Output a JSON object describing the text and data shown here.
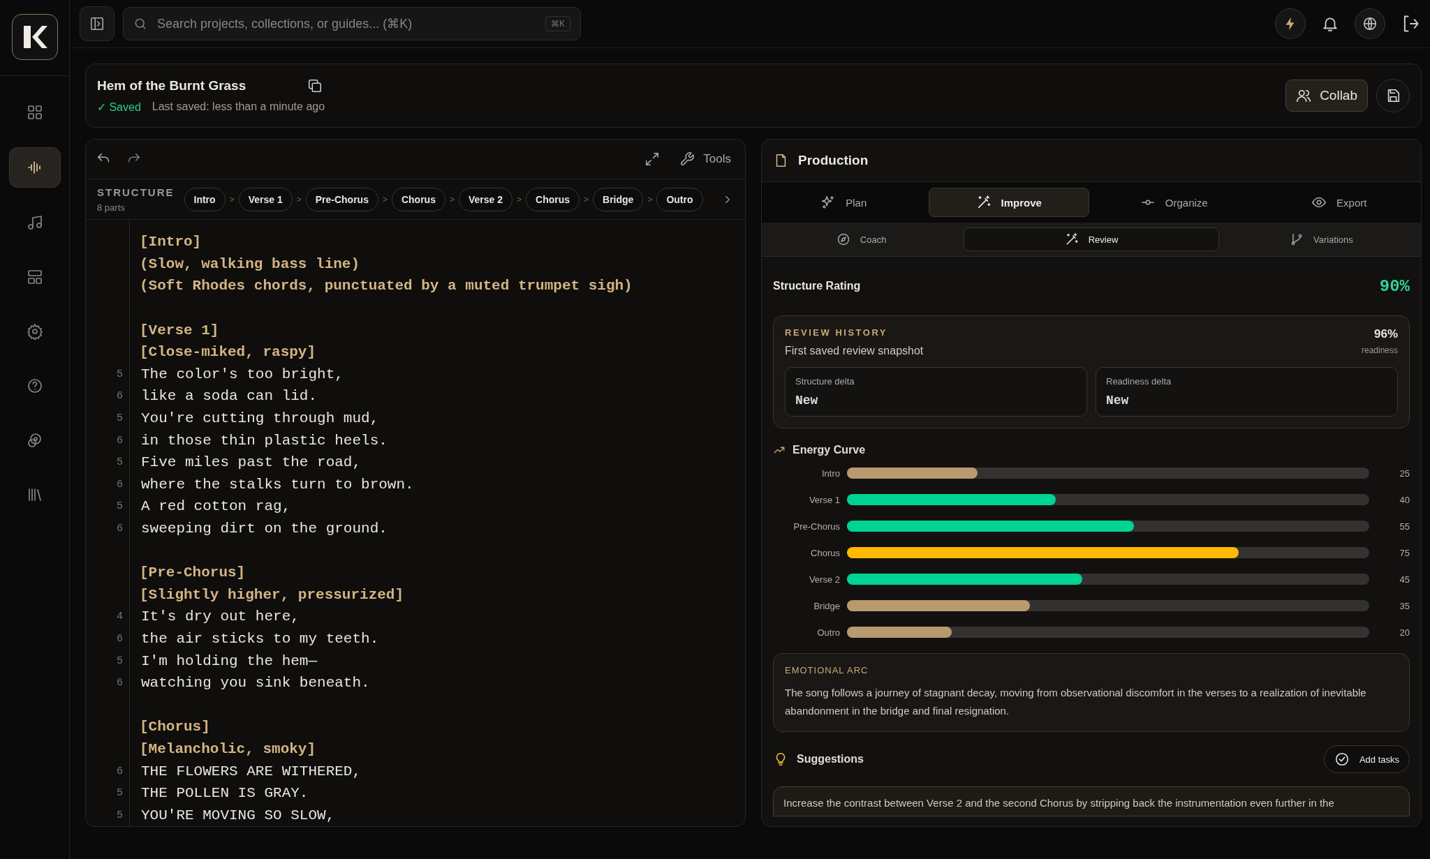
{
  "search": {
    "placeholder": "Search projects, collections, or guides... (⌘K)",
    "shortcut": "⌘K"
  },
  "sidebar": {
    "items": [
      {
        "kind": "grid",
        "selected": false
      },
      {
        "kind": "wave",
        "selected": true
      },
      {
        "kind": "note",
        "selected": false
      },
      {
        "kind": "layout",
        "selected": false
      },
      {
        "kind": "gear",
        "selected": false
      },
      {
        "kind": "help",
        "selected": false
      },
      {
        "kind": "palette",
        "selected": false
      },
      {
        "kind": "library",
        "selected": false
      }
    ]
  },
  "project": {
    "title": "Hem of the Burnt Grass",
    "status": "✓ Saved",
    "last_saved": "Last saved: less than a minute ago",
    "collab": "Collab"
  },
  "editor": {
    "tools": "Tools",
    "structure_label": "STRUCTURE",
    "parts_count": "8 parts",
    "sections": [
      {
        "label": "Intro"
      },
      {
        "label": "Verse 1"
      },
      {
        "label": "Pre-Chorus"
      },
      {
        "label": "Chorus"
      },
      {
        "label": "Verse 2"
      },
      {
        "label": "Chorus"
      },
      {
        "label": "Bridge"
      },
      {
        "label": "Outro"
      }
    ],
    "separator": ">",
    "lines": [
      {
        "kind": "tag",
        "text": "[Intro]"
      },
      {
        "kind": "tag",
        "text": "(Slow, walking bass line)"
      },
      {
        "kind": "tag",
        "text": "(Soft Rhodes chords, punctuated by a muted trumpet sigh)"
      },
      {
        "kind": "blank"
      },
      {
        "kind": "tag",
        "text": "[Verse 1]"
      },
      {
        "kind": "tag",
        "text": "[Close-miked, raspy]"
      },
      {
        "kind": "lyric",
        "number": "5",
        "text": "The color's too bright,"
      },
      {
        "kind": "lyric",
        "number": "6",
        "text": "like a soda can lid."
      },
      {
        "kind": "lyric",
        "number": "5",
        "text": "You're cutting through mud,"
      },
      {
        "kind": "lyric",
        "number": "6",
        "text": "in those thin plastic heels."
      },
      {
        "kind": "lyric",
        "number": "5",
        "text": "Five miles past the road,"
      },
      {
        "kind": "lyric",
        "number": "6",
        "text": "where the stalks turn to brown."
      },
      {
        "kind": "lyric",
        "number": "5",
        "text": "A red cotton rag,"
      },
      {
        "kind": "lyric",
        "number": "6",
        "text": "sweeping dirt on the ground."
      },
      {
        "kind": "blank"
      },
      {
        "kind": "tag",
        "text": "[Pre-Chorus]"
      },
      {
        "kind": "tag",
        "text": "[Slightly higher, pressurized]"
      },
      {
        "kind": "lyric",
        "number": "4",
        "text": "It's dry out here,"
      },
      {
        "kind": "lyric",
        "number": "6",
        "text": "the air sticks to my teeth."
      },
      {
        "kind": "lyric",
        "number": "5",
        "text": "I'm holding the hem—"
      },
      {
        "kind": "lyric",
        "number": "6",
        "text": "watching you sink beneath."
      },
      {
        "kind": "blank"
      },
      {
        "kind": "tag",
        "text": "[Chorus]"
      },
      {
        "kind": "tag",
        "text": "[Melancholic, smoky]"
      },
      {
        "kind": "lyric",
        "number": "6",
        "text": "THE FLOWERS ARE WITHERED,"
      },
      {
        "kind": "lyric",
        "number": "5",
        "text": "THE POLLEN IS GRAY."
      },
      {
        "kind": "lyric",
        "number": "5",
        "text": "YOU'RE MOVING SO SLOW,"
      }
    ]
  },
  "production": {
    "title": "Production",
    "tabs": [
      {
        "kind": "sparkle",
        "label": "Plan",
        "selected": false
      },
      {
        "kind": "wand",
        "label": "Improve",
        "selected": true
      },
      {
        "kind": "commit",
        "label": "Organize",
        "selected": false
      },
      {
        "kind": "eye",
        "label": "Export",
        "selected": false
      }
    ],
    "subtabs": [
      {
        "kind": "compass",
        "label": "Coach",
        "selected": false
      },
      {
        "kind": "wand",
        "label": "Review",
        "selected": true
      },
      {
        "kind": "branch",
        "label": "Variations",
        "selected": false
      }
    ],
    "rating_label": "Structure Rating",
    "rating": "90%",
    "history": {
      "title": "REVIEW HISTORY",
      "subtitle": "First saved review snapshot",
      "score": "96%",
      "score_label": "readiness",
      "deltas": [
        {
          "label": "Structure delta",
          "value": "New"
        },
        {
          "label": "Readiness delta",
          "value": "New"
        }
      ]
    },
    "energy": {
      "title": "Energy Curve",
      "rows": [
        {
          "label": "Intro",
          "level": 0.25,
          "value": "25",
          "color": "#b89a6e"
        },
        {
          "label": "Verse 1",
          "level": 0.4,
          "value": "40",
          "color": "#00d492"
        },
        {
          "label": "Pre-Chorus",
          "level": 0.55,
          "value": "55",
          "color": "#00d492"
        },
        {
          "label": "Chorus",
          "level": 0.75,
          "value": "75",
          "color": "#ffb900"
        },
        {
          "label": "Verse 2",
          "level": 0.45,
          "value": "45",
          "color": "#00d492"
        },
        {
          "label": "Bridge",
          "level": 0.35,
          "value": "35",
          "color": "#b89a6e"
        },
        {
          "label": "Outro",
          "level": 0.2,
          "value": "20",
          "color": "#b89a6e"
        }
      ]
    },
    "arc": {
      "title": "EMOTIONAL ARC",
      "text": "The song follows a journey of stagnant decay, moving from observational discomfort in the verses to a realization of inevitable abandonment in the bridge and final resignation."
    },
    "suggestions": {
      "title": "Suggestions",
      "button": "Add tasks",
      "items": [
        "Increase the contrast between Verse 2 and the second Chorus by stripping back the instrumentation even further in the"
      ]
    }
  }
}
